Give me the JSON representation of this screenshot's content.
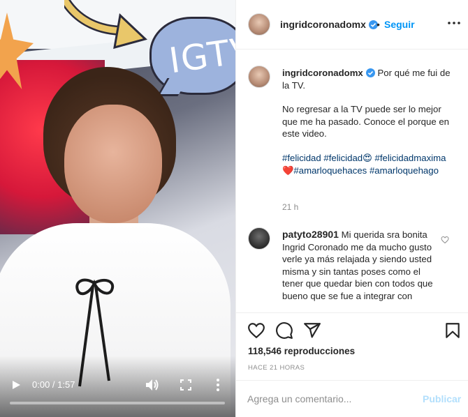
{
  "video": {
    "bubble_text": "IGTV",
    "time": "0:00 / 1:57",
    "progress": 0,
    "icons": [
      "play-icon",
      "volume-icon",
      "fullscreen-icon",
      "more-vertical-icon"
    ]
  },
  "header": {
    "username": "ingridcoronadomx",
    "separator": "•",
    "follow_label": "Seguir"
  },
  "caption": {
    "username": "ingridcoronadomx",
    "title": "Por qué me fui de la TV.",
    "body": "No regresar a la TV puede ser lo mejor que me ha pasado. Conoce el porque en este video.",
    "hashtags": [
      "#felicidad",
      "#felicidad😍",
      "#felicidadmaxima❤️",
      "#amarloquehaces",
      "#amarloquehago"
    ],
    "time_ago": "21 h"
  },
  "comment": {
    "username": "patyto28901",
    "text": "Mi querida sra bonita Ingrid Coronado me da mucho gusto verle ya más relajada y siendo usted misma y sin tantas poses como el tener que quedar bien con todos que bueno que se fue a integrar con"
  },
  "actions": {
    "views": "118,546 reproducciones",
    "date": "HACE 21 HORAS",
    "icons": [
      "heart-icon",
      "comment-icon",
      "share-icon",
      "bookmark-icon"
    ]
  },
  "add_comment": {
    "placeholder": "Agrega un comentario...",
    "post_label": "Publicar"
  },
  "colors": {
    "link_blue": "#0095f6",
    "hashtag_blue": "#00376b",
    "muted": "#8e8e8e",
    "disabled_blue": "#b2dffc"
  }
}
